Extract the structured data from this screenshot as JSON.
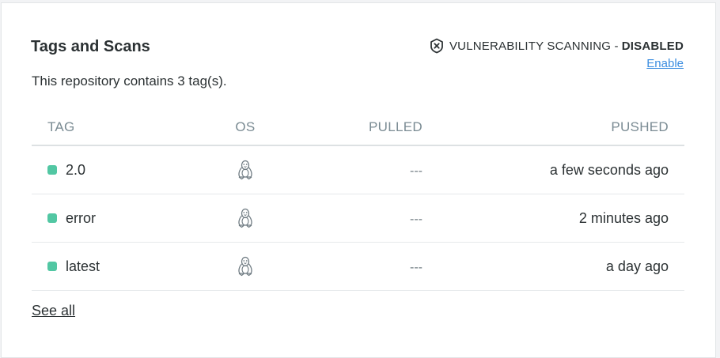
{
  "panel": {
    "title": "Tags and Scans",
    "description": "This repository contains 3 tag(s).",
    "see_all": "See all"
  },
  "scanning": {
    "label": "VULNERABILITY SCANNING -",
    "status": "DISABLED",
    "enable_link": "Enable",
    "icon": "shield-x-icon"
  },
  "table": {
    "headers": {
      "tag": "TAG",
      "os": "OS",
      "pulled": "PULLED",
      "pushed": "PUSHED"
    },
    "rows": [
      {
        "tag": "2.0",
        "os_icon": "linux-icon",
        "pulled": "---",
        "pushed": "a few seconds ago"
      },
      {
        "tag": "error",
        "os_icon": "linux-icon",
        "pulled": "---",
        "pushed": "2 minutes ago"
      },
      {
        "tag": "latest",
        "os_icon": "linux-icon",
        "pulled": "---",
        "pushed": "a day ago"
      }
    ]
  },
  "colors": {
    "tag_dot": "#52c7a3",
    "link": "#3b8de0",
    "header_text": "#7a8b93"
  }
}
